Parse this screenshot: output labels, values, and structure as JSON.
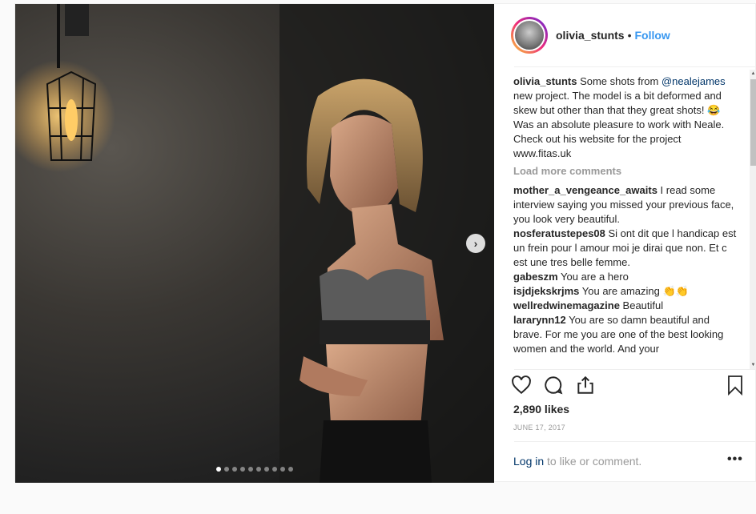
{
  "post": {
    "username": "olivia_stunts",
    "separator": "•",
    "follow_label": "Follow",
    "caption": {
      "username": "olivia_stunts",
      "text_a": " Some shots from ",
      "mention": "@nealejames",
      "text_b": " new project. The model is a bit deformed and skew but other than that they great shots! 😂 Was an absolute pleasure to work with Neale. Check out his website for the project www.fitas.uk"
    },
    "load_more_label": "Load more comments",
    "comments": [
      {
        "user": "mother_a_vengeance_awaits",
        "text": " I read some interview saying you missed your previous face, you look very beautiful."
      },
      {
        "user": "nosferatustepes08",
        "text": " Si ont dit que l handicap est un frein pour l amour moi je dirai que non. Et c est une tres belle femme."
      },
      {
        "user": "gabeszm",
        "text": " You are a hero"
      },
      {
        "user": "isjdjekskrjms",
        "text": " You are amazing 👏👏"
      },
      {
        "user": "wellredwinemagazine",
        "text": " Beautiful"
      },
      {
        "user": "lararynn12",
        "text": " You are so damn beautiful and brave. For me you are one of the best looking women and the world. And your"
      }
    ],
    "likes": "2,890 likes",
    "date": "JUNE 17, 2017",
    "login_link": "Log in",
    "login_rest": " to like or comment.",
    "more_label": "•••",
    "next_arrow": "›",
    "carousel": {
      "count": 10,
      "active": 0
    },
    "icons": [
      "heart-icon",
      "comment-icon",
      "share-icon",
      "bookmark-icon"
    ],
    "colors": {
      "link": "#3897f0",
      "mention": "#003569",
      "muted": "#999999",
      "text": "#262626"
    }
  }
}
